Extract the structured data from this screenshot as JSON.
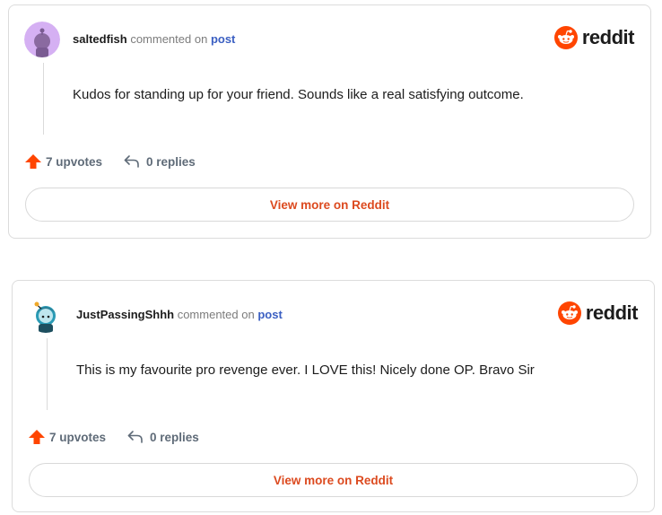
{
  "brand": {
    "word": "reddit",
    "orange": "#ff4500",
    "link_color": "#3b5fc2",
    "action_color": "#dc4a1f"
  },
  "comments": [
    {
      "username": "saltedfish",
      "mid_text": "commented on",
      "link_text": "post",
      "body": "Kudos for standing up for your friend. Sounds like a real satisfying outcome.",
      "upvotes": "7 upvotes",
      "replies": "0 replies",
      "button": "View more on Reddit",
      "avatar_icon": "purple-snoo-avatar-icon"
    },
    {
      "username": "JustPassingShhh",
      "mid_text": "commented on",
      "link_text": "post",
      "body": "This is my favourite pro revenge ever. I LOVE this! Nicely done OP. Bravo Sir",
      "upvotes": "7 upvotes",
      "replies": "0 replies",
      "button": "View more on Reddit",
      "avatar_icon": "teal-snoo-avatar-icon"
    }
  ]
}
